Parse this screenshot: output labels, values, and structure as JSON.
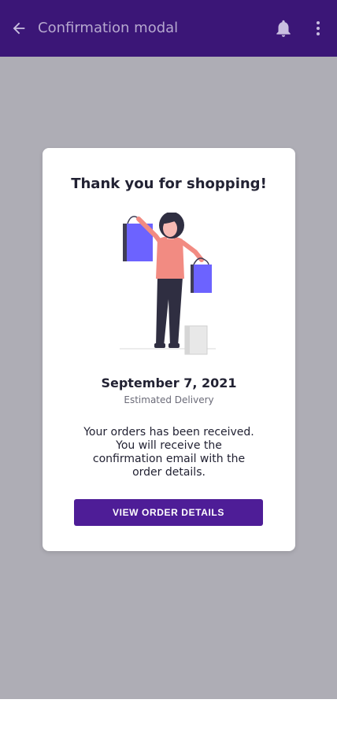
{
  "app_bar": {
    "title": "Confirmation modal",
    "background": "#3b1677",
    "icons": {
      "back": "arrow-left-icon",
      "notifications": "bell-icon",
      "menu": "more-vertical-icon"
    }
  },
  "modal": {
    "title": "Thank you for shopping!",
    "delivery_date": "September 7, 2021",
    "delivery_label": "Estimated Delivery",
    "message_lines": [
      "Your orders has been received.",
      "You will receive the",
      "confirmation email with the",
      "order details."
    ],
    "button_label": "VIEW ORDER DETAILS",
    "accent": "#4e1d97",
    "illustration": "woman-with-shopping-bags-illustration"
  }
}
